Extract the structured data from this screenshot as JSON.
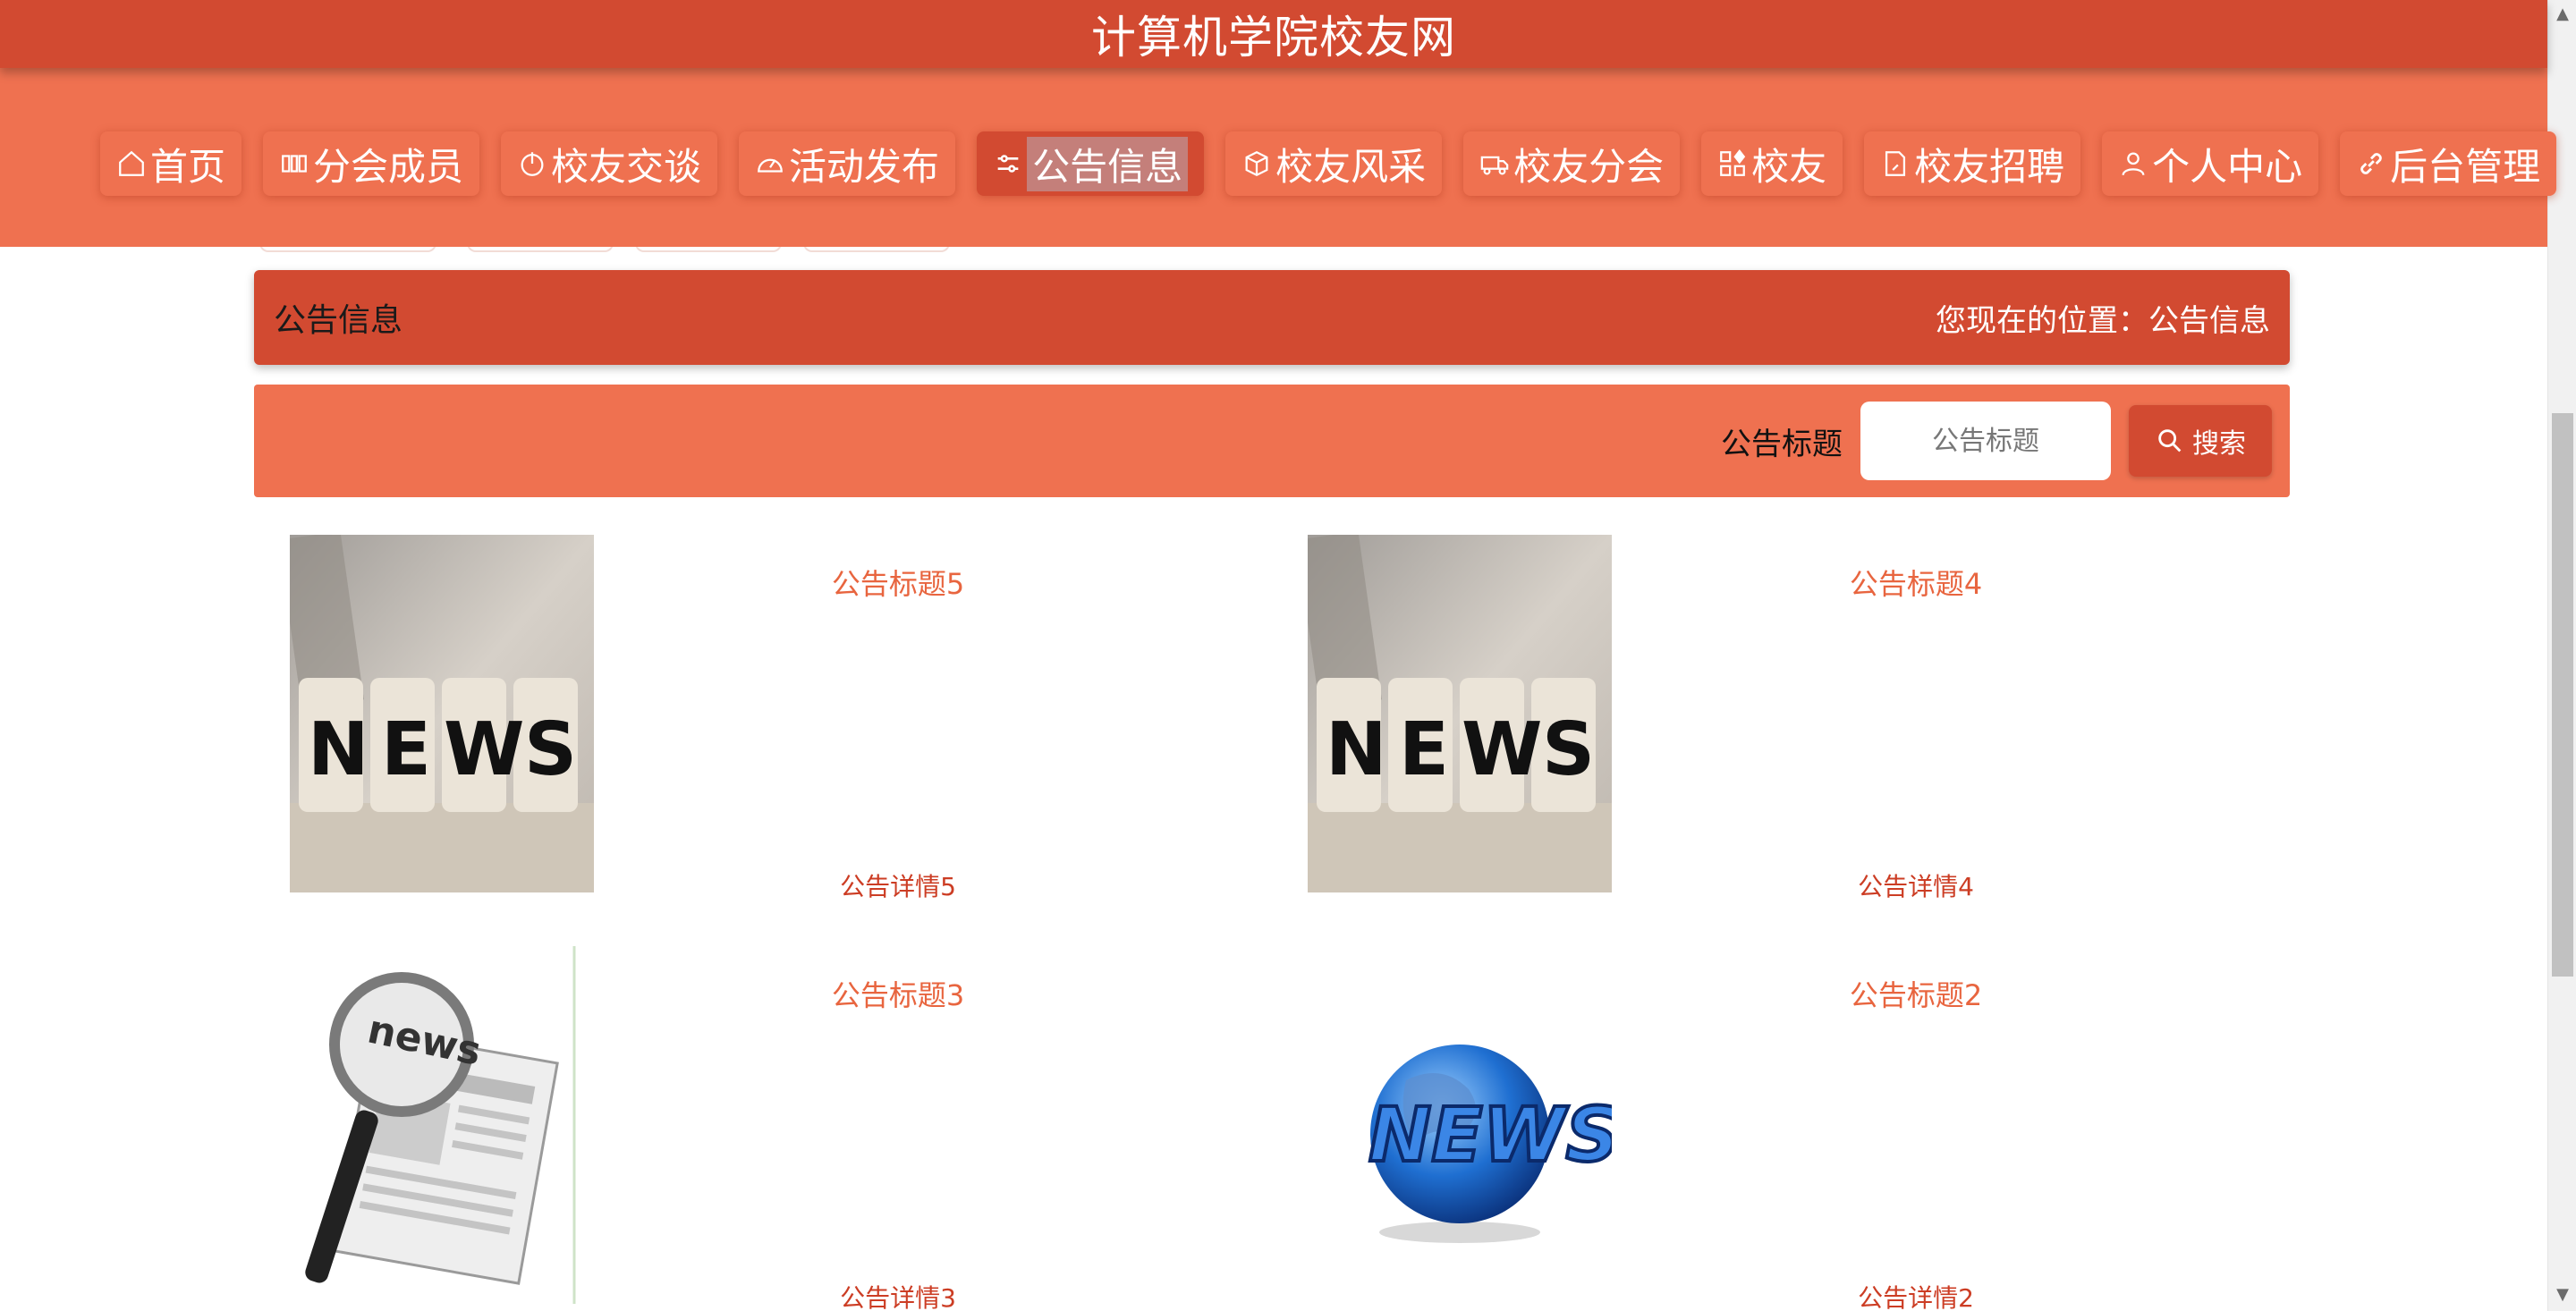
{
  "site_title": "计算机学院校友网",
  "nav": [
    {
      "label": "首页",
      "icon": "home-icon"
    },
    {
      "label": "分会成员",
      "icon": "members-icon"
    },
    {
      "label": "校友交谈",
      "icon": "power-icon"
    },
    {
      "label": "活动发布",
      "icon": "gauge-icon"
    },
    {
      "label": "公告信息",
      "icon": "sliders-icon",
      "active": true
    },
    {
      "label": "校友风采",
      "icon": "cube-icon"
    },
    {
      "label": "校友分会",
      "icon": "truck-icon"
    },
    {
      "label": "校友",
      "icon": "grid-icon"
    },
    {
      "label": "校友招聘",
      "icon": "document-icon"
    },
    {
      "label": "个人中心",
      "icon": "user-icon"
    },
    {
      "label": "后台管理",
      "icon": "link-icon"
    }
  ],
  "breadcrumb": {
    "title": "公告信息",
    "location_prefix": "您现在的位置：",
    "location": "公告信息"
  },
  "search": {
    "label": "公告标题",
    "placeholder": "公告标题",
    "button": "搜索"
  },
  "cards": [
    {
      "title": "公告标题5",
      "detail": "公告详情5",
      "image": "news-blocks-image"
    },
    {
      "title": "公告标题4",
      "detail": "公告详情4",
      "image": "news-blocks-image"
    },
    {
      "title": "公告标题3",
      "detail": "公告详情3",
      "image": "newspaper-magnifier-image"
    },
    {
      "title": "公告标题2",
      "detail": "公告详情2",
      "image": "news-globe-image"
    }
  ],
  "colors": {
    "primary_dark": "#d24a31",
    "primary": "#ef7150",
    "title_text": "#e8653f"
  }
}
